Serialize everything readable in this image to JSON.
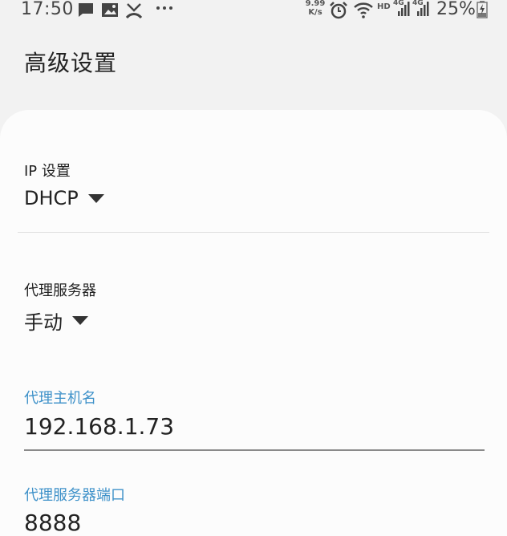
{
  "status_bar": {
    "time": "17:50",
    "net_speed_value": "9.99",
    "net_speed_unit": "K/s",
    "hd_label": "HD",
    "signal_labels": [
      "4G",
      "4G"
    ],
    "battery_percent": "25%"
  },
  "header": {
    "title": "高级设置"
  },
  "form": {
    "ip_settings": {
      "label": "IP 设置",
      "value": "DHCP"
    },
    "proxy": {
      "label": "代理服务器",
      "value": "手动"
    },
    "proxy_hostname": {
      "label": "代理主机名",
      "value": "192.168.1.73"
    },
    "proxy_port": {
      "label": "代理服务器端口",
      "value": "8888"
    }
  },
  "colors": {
    "accent": "#3e91c9",
    "background": "#f2f2f2",
    "card": "#fcfcfc"
  }
}
